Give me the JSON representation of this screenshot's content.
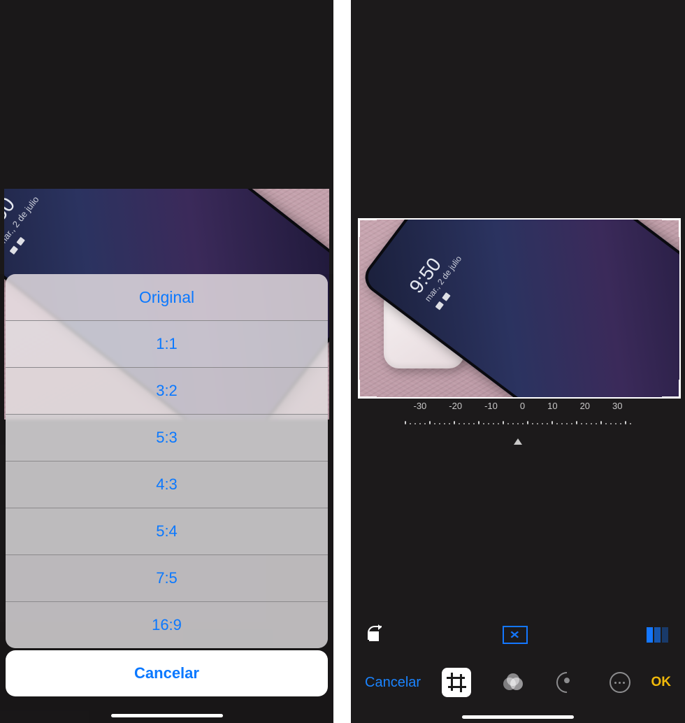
{
  "photo_lockscreen": {
    "time": "9:50",
    "date": "mar., 2 de julio"
  },
  "left": {
    "action_sheet": {
      "options": [
        "Original",
        "1:1",
        "3:2",
        "5:3",
        "4:3",
        "5:4",
        "7:5",
        "16:9"
      ],
      "cancel": "Cancelar"
    }
  },
  "right": {
    "rotation_dial": {
      "labels": [
        "-30",
        "-20",
        "-10",
        "0",
        "10",
        "20",
        "30"
      ],
      "value": 0
    },
    "bottom_bar": {
      "cancel": "Cancelar",
      "ok": "OK"
    }
  },
  "colors": {
    "ios_blue": "#0a78ff",
    "accent_yellow": "#f0b90a"
  }
}
